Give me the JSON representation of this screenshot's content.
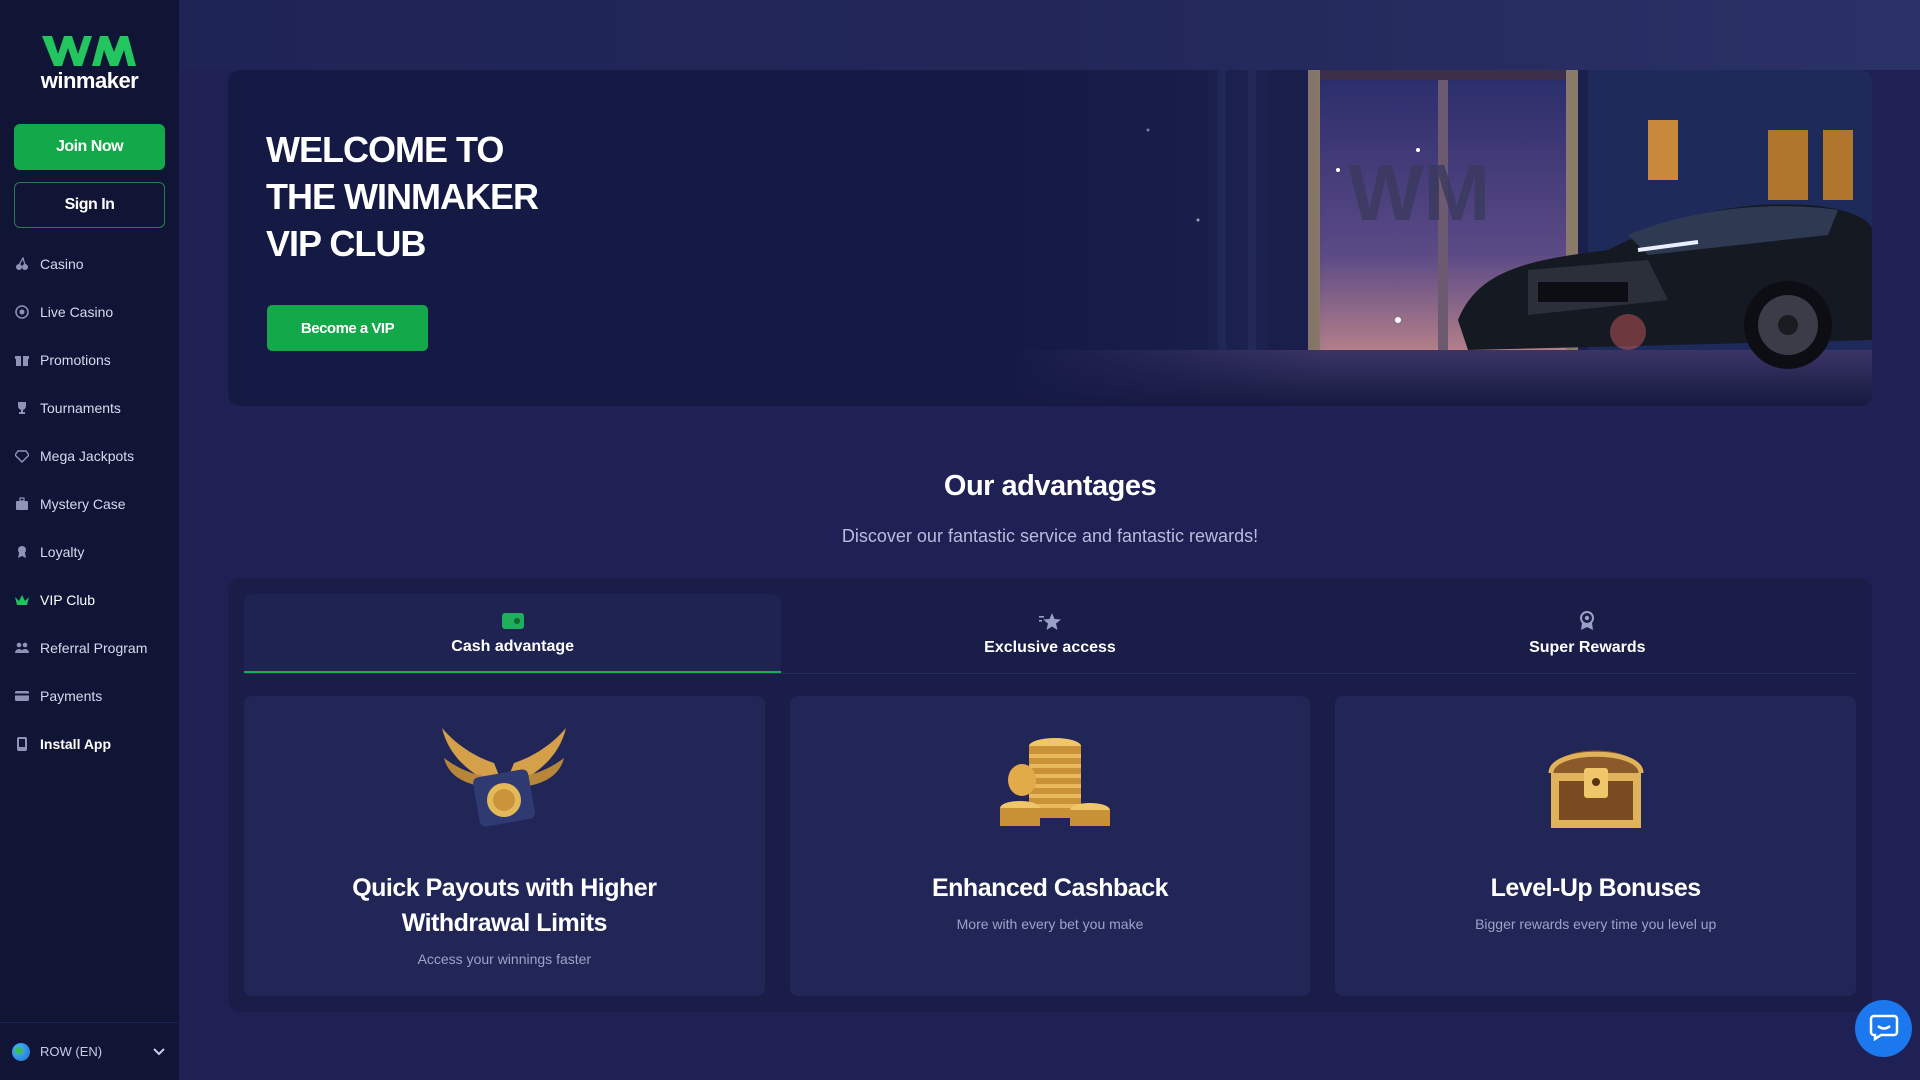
{
  "brand": {
    "logo_text": "winmaker",
    "accent_color": "#13a84a",
    "logo_color": "#22c55e"
  },
  "sidebar": {
    "join_label": "Join Now",
    "signin_label": "Sign In",
    "items": [
      {
        "label": "Casino",
        "icon": "cherry-icon"
      },
      {
        "label": "Live Casino",
        "icon": "chip-icon"
      },
      {
        "label": "Promotions",
        "icon": "gift-icon"
      },
      {
        "label": "Tournaments",
        "icon": "trophy-icon"
      },
      {
        "label": "Mega Jackpots",
        "icon": "diamond-icon"
      },
      {
        "label": "Mystery Case",
        "icon": "case-icon"
      },
      {
        "label": "Loyalty",
        "icon": "medal-icon"
      },
      {
        "label": "VIP Club",
        "icon": "crown-icon",
        "active": true
      },
      {
        "label": "Referral Program",
        "icon": "people-icon"
      },
      {
        "label": "Payments",
        "icon": "card-icon"
      },
      {
        "label": "Install App",
        "icon": "phone-icon"
      }
    ],
    "language": "ROW (EN)"
  },
  "hero": {
    "title_line1": "WELCOME TO",
    "title_line2": "THE WINMAKER",
    "title_line3": "VIP CLUB",
    "cta_label": "Become a VIP"
  },
  "advantages": {
    "title": "Our advantages",
    "subtitle": "Discover our fantastic service and fantastic rewards!",
    "tabs": [
      {
        "label": "Cash advantage",
        "icon": "wallet-icon",
        "active": true
      },
      {
        "label": "Exclusive access",
        "icon": "star-icon"
      },
      {
        "label": "Super Rewards",
        "icon": "reward-icon"
      }
    ],
    "cards": [
      {
        "title": "Quick Payouts with Higher Withdrawal Limits",
        "desc": "Access your winnings faster",
        "icon": "winged-coin-icon"
      },
      {
        "title": "Enhanced Cashback",
        "desc": "More with every bet you make",
        "icon": "coin-stack-icon"
      },
      {
        "title": "Level-Up Bonuses",
        "desc": "Bigger rewards every time you level up",
        "icon": "treasure-chest-icon"
      }
    ]
  }
}
